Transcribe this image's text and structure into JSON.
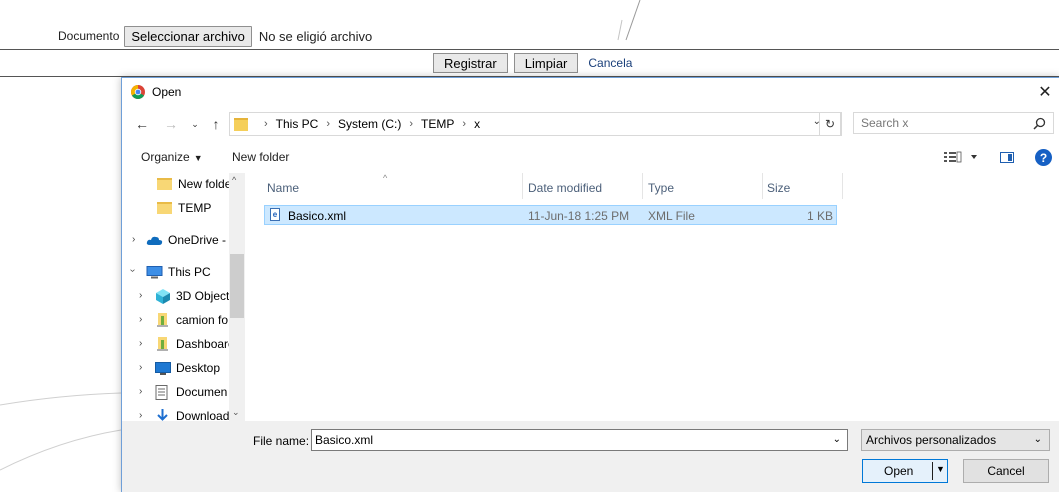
{
  "page": {
    "document_label": "Documento",
    "file_button": "Seleccionar archivo",
    "file_status": "No se eligió archivo",
    "register_button": "Registrar",
    "clear_button": "Limpiar",
    "cancel_link": "Cancela"
  },
  "dialog": {
    "title": "Open",
    "address": [
      "This PC",
      "System (C:)",
      "TEMP",
      "x"
    ],
    "search_placeholder": "Search x",
    "toolbar": {
      "organize": "Organize",
      "new_folder": "New folder"
    },
    "nav_tree": [
      {
        "label": "New folde",
        "icon": "folder-icon"
      },
      {
        "label": "TEMP",
        "icon": "folder-icon"
      },
      {
        "label": "OneDrive - .",
        "icon": "cloud-icon"
      },
      {
        "label": "This PC",
        "icon": "computer-icon"
      },
      {
        "label": "3D Object",
        "icon": "cube-icon"
      },
      {
        "label": "camion fo",
        "icon": "user-folder-icon"
      },
      {
        "label": "Dashboarc",
        "icon": "user-folder-icon"
      },
      {
        "label": "Desktop",
        "icon": "desktop-icon"
      },
      {
        "label": "Documen",
        "icon": "document-icon"
      },
      {
        "label": "Download",
        "icon": "download-icon"
      }
    ],
    "columns": [
      "Name",
      "Date modified",
      "Type",
      "Size"
    ],
    "files": [
      {
        "name": "Basico.xml",
        "date": "11-Jun-18 1:25 PM",
        "type": "XML File",
        "size": "1 KB"
      }
    ],
    "file_name_label": "File name:",
    "file_name_value": "Basico.xml",
    "file_type": "Archivos personalizados",
    "open_button": "Open",
    "cancel_button": "Cancel"
  },
  "colors": {
    "selection": "#cce8ff",
    "accent": "#0078d7"
  }
}
